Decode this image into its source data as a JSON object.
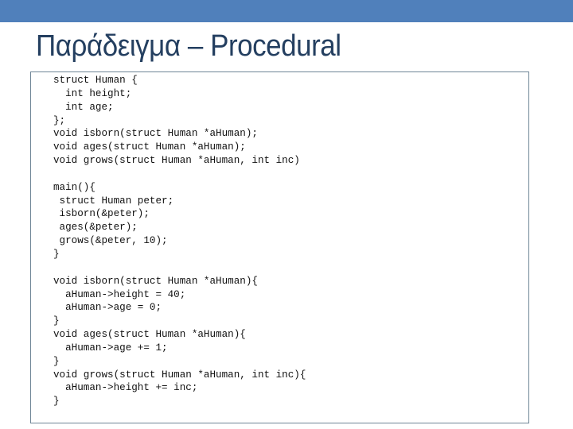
{
  "slide": {
    "header_color": "#5080bb",
    "title": "Παράδειγμα – Procedural",
    "code_lines": [
      "struct Human {",
      "  int height;",
      "  int age;",
      "};",
      "void isborn(struct Human *aHuman);",
      "void ages(struct Human *aHuman);",
      "void grows(struct Human *aHuman, int inc)",
      "",
      "main(){",
      " struct Human peter;",
      " isborn(&peter);",
      " ages(&peter);",
      " grows(&peter, 10);",
      "}",
      "",
      "void isborn(struct Human *aHuman){",
      "  aHuman->height = 40;",
      "  aHuman->age = 0;",
      "}",
      "void ages(struct Human *aHuman){",
      "  aHuman->age += 1;",
      "}",
      "void grows(struct Human *aHuman, int inc){",
      "  aHuman->height += inc;",
      "}"
    ]
  }
}
